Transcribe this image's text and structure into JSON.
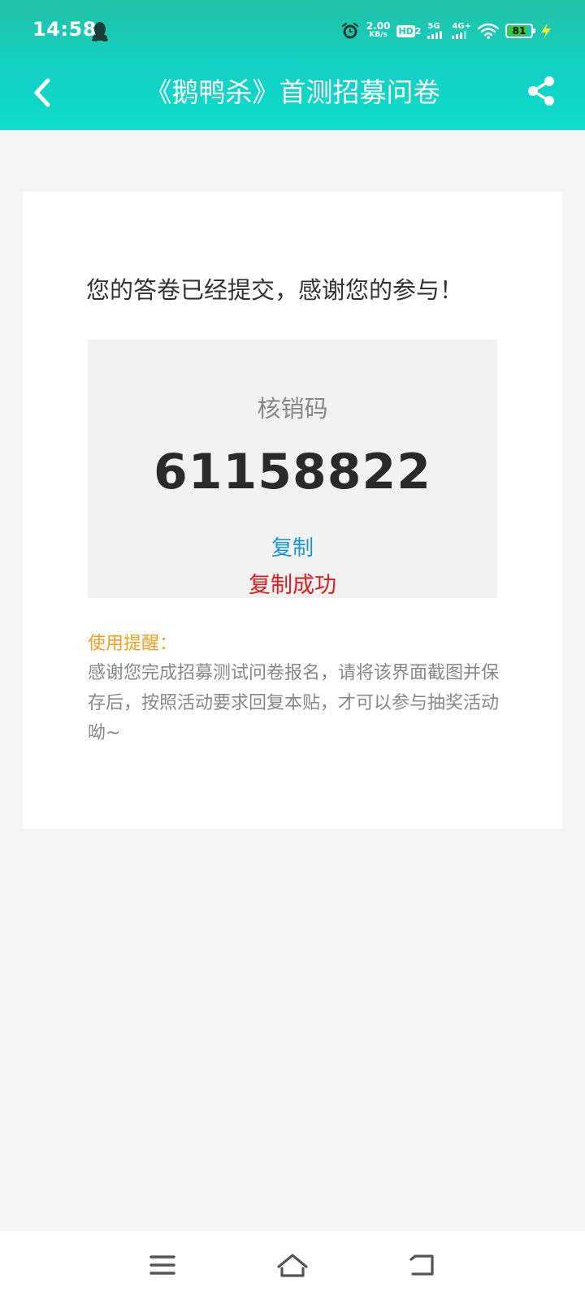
{
  "status_bar": {
    "time": "14:58",
    "speed_value": "2.00",
    "speed_unit": "KB/s",
    "hd_label": "HD",
    "hd_sub": "2",
    "net1": "5G",
    "net2": "4G+",
    "battery": "81"
  },
  "header": {
    "title": "《鹅鸭杀》首测招募问卷"
  },
  "result": {
    "thanks": "您的答卷已经提交，感谢您的参与！",
    "code_label": "核销码",
    "code_value": "61158822",
    "copy_label": "复制",
    "copy_success": "复制成功"
  },
  "tips": {
    "heading": "使用提醒：",
    "body": "感谢您完成招募测试问卷报名，请将该界面截图并保存后，按照活动要求回复本贴，才可以参与抽奖活动呦~"
  },
  "colors": {
    "header_teal": "#11d2c4",
    "copy_link": "#1a96d6",
    "copy_success": "#e21b1b",
    "tips_heading": "#f0a020",
    "battery": "#38c830"
  },
  "levels": {
    "battery_percent": 81
  }
}
